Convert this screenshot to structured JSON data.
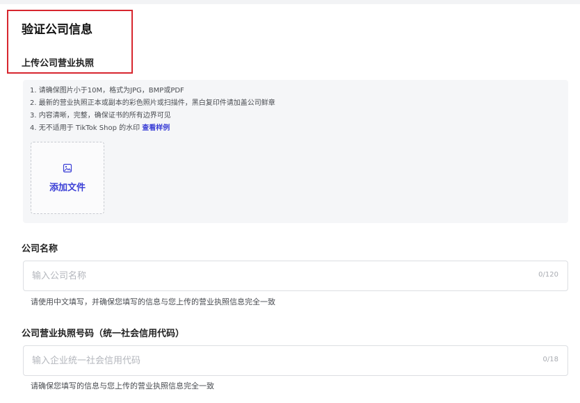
{
  "section": {
    "title": "验证公司信息",
    "subtitle": "上传公司营业执照"
  },
  "upload": {
    "requirements": [
      "1. 请确保图片小于10M，格式为JPG，BMP或PDF",
      "2. 最新的营业执照正本或副本的彩色照片或扫描件，黑白复印件请加盖公司鲜章",
      "3. 内容清晰，完整，确保证书的所有边界可见"
    ],
    "requirement_4_prefix": "4. 无不适用于 TikTok Shop 的水印",
    "example_link": "查看样例",
    "add_file_label": "添加文件",
    "icon": "image-icon"
  },
  "company_name": {
    "label": "公司名称",
    "placeholder": "输入公司名称",
    "value": "",
    "counter": "0/120",
    "hint": "请使用中文填写，并确保您填写的信息与您上传的营业执照信息完全一致"
  },
  "license_number": {
    "label": "公司营业执照号码（统一社会信用代码）",
    "placeholder": "输入企业统一社会信用代码",
    "value": "",
    "counter": "0/18",
    "hint": "请确保您填写的信息与您上传的营业执照信息完全一致"
  },
  "colors": {
    "accent": "#3b3fd6",
    "highlight": "#d7262e",
    "panel_bg": "#f5f6f8"
  }
}
